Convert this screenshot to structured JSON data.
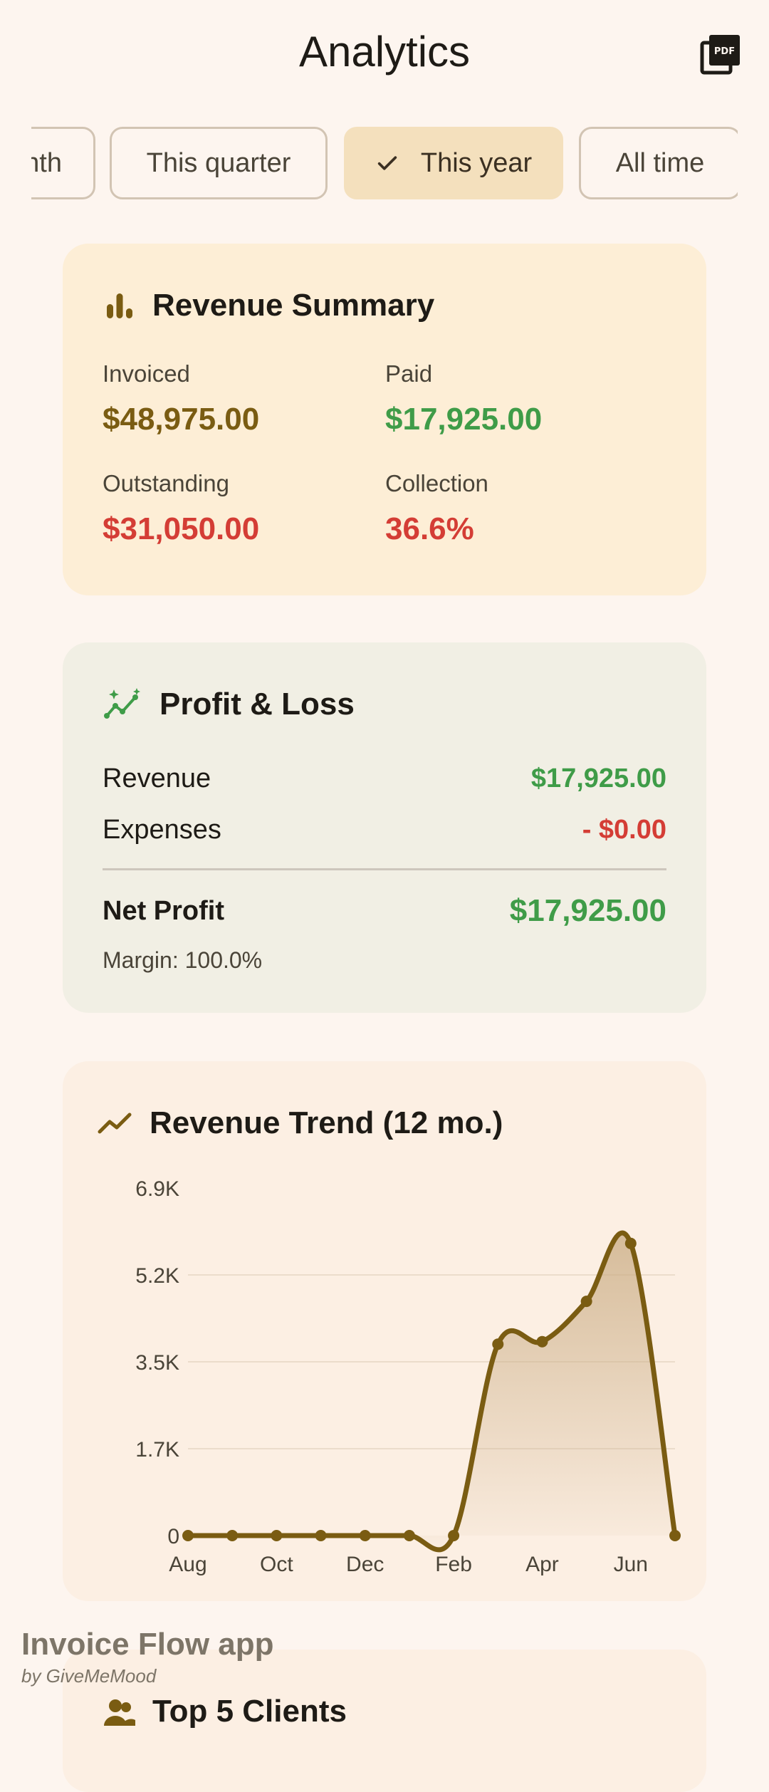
{
  "appbar": {
    "title": "Analytics",
    "export_icon": "pdf-icon"
  },
  "filters": {
    "chips": [
      {
        "label": "This month",
        "visible_text": "nth",
        "selected": false
      },
      {
        "label": "This quarter",
        "selected": false
      },
      {
        "label": "This year",
        "selected": true
      },
      {
        "label": "All time",
        "selected": false
      }
    ]
  },
  "revenue_summary": {
    "icon": "bar-chart-icon",
    "title": "Revenue Summary",
    "invoiced_label": "Invoiced",
    "invoiced_value": "$48,975.00",
    "paid_label": "Paid",
    "paid_value": "$17,925.00",
    "outstanding_label": "Outstanding",
    "outstanding_value": "$31,050.00",
    "collection_label": "Collection",
    "collection_value": "36.6%"
  },
  "profit_loss": {
    "icon": "sparkline-icon",
    "title": "Profit & Loss",
    "revenue_label": "Revenue",
    "revenue_value": "$17,925.00",
    "expenses_label": "Expenses",
    "expenses_value": "- $0.00",
    "net_label": "Net Profit",
    "net_value": "$17,925.00",
    "margin": "Margin: 100.0%"
  },
  "revenue_trend": {
    "icon": "trend-line-icon",
    "title": "Revenue Trend (12 mo.)"
  },
  "chart_data": {
    "type": "area",
    "title": "Revenue Trend (12 mo.)",
    "x": [
      "Aug",
      "Sep",
      "Oct",
      "Nov",
      "Dec",
      "Jan",
      "Feb",
      "Mar",
      "Apr",
      "May",
      "Jun",
      "Jul"
    ],
    "x_tick_labels": [
      "Aug",
      "Oct",
      "Dec",
      "Feb",
      "Apr",
      "Jun"
    ],
    "y_tick_labels": [
      "0",
      "1.7K",
      "3.5K",
      "5.2K",
      "6.9K"
    ],
    "y_ticks": [
      0,
      1725,
      3450,
      5175,
      6900
    ],
    "ylim": [
      0,
      6900
    ],
    "values": [
      0,
      0,
      0,
      0,
      0,
      0,
      0,
      3800,
      3850,
      4650,
      5800,
      0
    ],
    "line_color": "#7a5c12",
    "fill_color": "#d8c0a0",
    "grid": true
  },
  "top_clients": {
    "icon": "people-icon",
    "title": "Top 5 Clients"
  },
  "watermark": {
    "app": "Invoice Flow app",
    "by": "by GiveMeMood"
  },
  "colors": {
    "background": "#fdf5ef",
    "accent": "#7a5c12",
    "positive": "#3f9c48",
    "negative": "#d43d35",
    "chip_selected": "#f4e0bd"
  }
}
